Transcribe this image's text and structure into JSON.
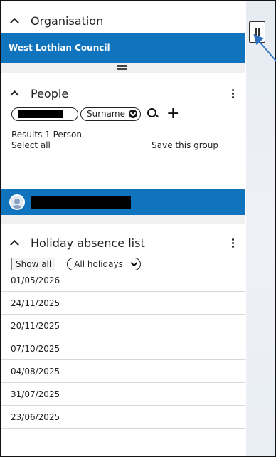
{
  "organisation": {
    "title": "Organisation",
    "selected": "West Lothian Council"
  },
  "people": {
    "title": "People",
    "search_select": "Surname",
    "results_text": "Results 1 Person",
    "select_all": "Select all",
    "save_group": "Save this group"
  },
  "holiday": {
    "title": "Holiday absence list",
    "show_all": "Show all",
    "filter": "All holidays",
    "dates": [
      "01/05/2026",
      "24/11/2025",
      "20/11/2025",
      "07/10/2025",
      "04/08/2025",
      "31/07/2025",
      "23/06/2025"
    ]
  },
  "colors": {
    "accent": "#0f73be",
    "pointer": "#3a78c9"
  },
  "icons": {
    "collapse": "chevron-up-icon",
    "menu": "kebab-menu-icon",
    "search": "search-icon",
    "add": "plus-icon",
    "columns": "column-toggle-icon",
    "avatar": "user-avatar-icon"
  }
}
